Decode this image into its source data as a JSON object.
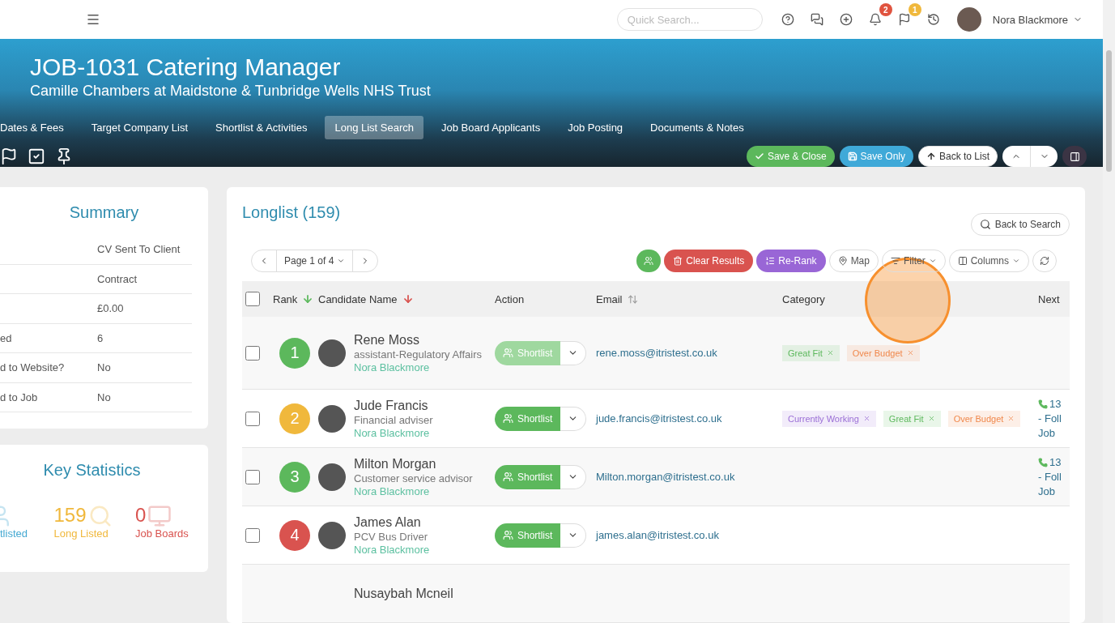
{
  "topbar": {
    "search": {
      "placeholder": "Quick Search..."
    },
    "notifications": {
      "badge": "2"
    },
    "flags": {
      "badge": "1"
    },
    "user": {
      "name": "Nora Blackmore"
    }
  },
  "header": {
    "title": "JOB-1031 Catering Manager",
    "subtitle": "Camille Chambers at Maidstone & Tunbridge Wells NHS Trust",
    "tabs": [
      {
        "label": "Dates & Fees",
        "selected": false
      },
      {
        "label": "Target Company List",
        "selected": false
      },
      {
        "label": "Shortlist & Activities",
        "selected": false
      },
      {
        "label": "Long List Search",
        "selected": true
      },
      {
        "label": "Job Board Applicants",
        "selected": false
      },
      {
        "label": "Job Posting",
        "selected": false
      },
      {
        "label": "Documents & Notes",
        "selected": false
      }
    ],
    "buttons": [
      {
        "label": "Save & Close",
        "kind": "success"
      },
      {
        "label": "Save Only",
        "kind": "info"
      },
      {
        "label": "Back to List",
        "kind": "plain"
      }
    ]
  },
  "summary": {
    "title": "Summary",
    "rows": [
      {
        "value": "CV Sent To Client"
      },
      {
        "value": "Contract"
      },
      {
        "value": "£0.00"
      },
      {
        "label": "ed",
        "value": "6"
      },
      {
        "label": "d to Website?",
        "value": "No"
      },
      {
        "label": "d to Job",
        "value": "No"
      }
    ]
  },
  "key_statistics": {
    "title": "Key Statistics",
    "items": [
      {
        "label": "tlisted",
        "color": "#45a9d2",
        "kind": "shortlisted"
      },
      {
        "value": "159",
        "label": "Long Listed",
        "color": "#f0b83c",
        "kind": "longlisted"
      },
      {
        "value": "0",
        "label": "Job Boards",
        "color": "#d9534f",
        "kind": "boards"
      }
    ]
  },
  "longlist": {
    "title": "Longlist (159)",
    "back_to_search": "Back to Search",
    "pager": {
      "label": "Page 1 of 4"
    },
    "toolbar": [
      {
        "kind": "shortlist"
      },
      {
        "kind": "clear",
        "label": "Clear Results"
      },
      {
        "kind": "rerank",
        "label": "Re-Rank"
      },
      {
        "kind": "map",
        "label": "Map"
      },
      {
        "kind": "filter",
        "label": "Filter"
      },
      {
        "kind": "columns",
        "label": "Columns"
      },
      {
        "kind": "refresh"
      }
    ],
    "select_all": {
      "checked": false
    },
    "columns": [
      {
        "label": "Rank",
        "kind": "ascending"
      },
      {
        "label": "Candidate Name",
        "kind": "descending"
      },
      {
        "label": "Action",
        "kind": "plain"
      },
      {
        "label": "Email",
        "kind": "unsorted"
      },
      {
        "label": "Category",
        "kind": "plain"
      },
      {
        "label": "Next",
        "kind": "plain"
      }
    ],
    "rows": [
      {
        "checked": false,
        "rank": "1",
        "color": "#5cb85c",
        "name": "Rene Moss",
        "title": "assistant-Regulatory Affairs",
        "owner": "Nora Blackmore",
        "action": {
          "label": "Shortlist",
          "disabled": true
        },
        "email": "rene.moss@itristest.co.uk",
        "tags": [
          {
            "label": "Great Fit",
            "color": "#5cb85c"
          },
          {
            "label": "Over Budget",
            "color": "#f0884c"
          }
        ]
      },
      {
        "checked": false,
        "rank": "2",
        "color": "#f0b83c",
        "name": "Jude Francis",
        "title": "Financial adviser",
        "owner": "Nora Blackmore",
        "action": {
          "label": "Shortlist",
          "disabled": false
        },
        "email": "jude.francis@itristest.co.uk",
        "tags": [
          {
            "label": "Currently Working",
            "color": "#9b6fd6"
          },
          {
            "label": "Great Fit",
            "color": "#5cb85c"
          },
          {
            "label": "Over Budget",
            "color": "#f0884c"
          }
        ],
        "next": [
          "13",
          "- Foll",
          "Job"
        ]
      },
      {
        "checked": false,
        "rank": "3",
        "color": "#5cb85c",
        "name": "Milton Morgan",
        "title": "Customer service advisor",
        "owner": "Nora Blackmore",
        "action": {
          "label": "Shortlist",
          "disabled": false
        },
        "email": "Milton.morgan@itristest.co.uk",
        "tags": [],
        "next": [
          "13",
          "- Foll",
          "Job"
        ]
      },
      {
        "checked": false,
        "rank": "4",
        "color": "#d9534f",
        "name": "James Alan",
        "title": "PCV Bus Driver",
        "owner": "Nora Blackmore",
        "action": {
          "label": "Shortlist",
          "disabled": false
        },
        "email": "james.alan@itristest.co.uk",
        "tags": []
      },
      {
        "name": "Nusaybah Mcneil"
      }
    ]
  }
}
